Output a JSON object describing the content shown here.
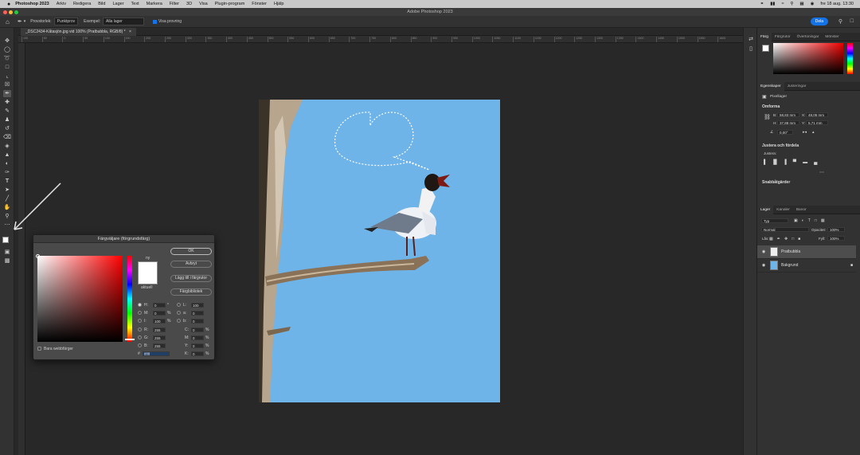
{
  "menubar": {
    "apple": "",
    "app_name": "Photoshop 2023",
    "items": [
      "Arkiv",
      "Redigera",
      "Bild",
      "Lager",
      "Text",
      "Markera",
      "Filter",
      "3D",
      "Visa",
      "Plugin-program",
      "Fönster",
      "Hjälp"
    ],
    "clock": "fre 18 aug. 13:30"
  },
  "window": {
    "title": "Adobe Photoshop 2023"
  },
  "options_bar": {
    "sample_size_label": "Provstorlek:",
    "sample_size_value": "Punktprov",
    "sample_label": "Exempel:",
    "sample_value": "Alla lager",
    "show_ring_label": "Visa provring",
    "share_label": "Dela"
  },
  "document": {
    "tab_label": "_DSC2434-Kåtasjön.jpg vid 100% (Pratbubbla, RGB/8) *"
  },
  "ruler": {
    "ticks": [
      "100",
      "50",
      "0",
      "50",
      "100",
      "150",
      "200",
      "250",
      "300",
      "350",
      "400",
      "450",
      "500",
      "550",
      "600",
      "650",
      "700",
      "750",
      "800",
      "850",
      "900",
      "950",
      "1000",
      "1050",
      "1100",
      "1150",
      "1200",
      "1250",
      "1300",
      "1350",
      "1400",
      "1450",
      "1500",
      "1550",
      "1600"
    ]
  },
  "color_picker": {
    "title": "Färgväljare (förgrundsfärg)",
    "new_label": "ny",
    "current_label": "aktuell",
    "ok": "OK",
    "cancel": "Avbryt",
    "add_swatch": "Lägg till i färgrutor",
    "libraries": "Färgbibliotek",
    "web_only": "Bara webbfärger",
    "hsb": {
      "H": "0",
      "H_unit": "°",
      "S": "0",
      "S_unit": "%",
      "B": "100",
      "B_unit": "%"
    },
    "rgb": {
      "R": "255",
      "G": "255",
      "B": "255"
    },
    "lab": {
      "L": "100",
      "a": "0",
      "b": "0"
    },
    "cmyk": {
      "C": "0",
      "M": "0",
      "Y": "0",
      "K": "0",
      "unit": "%"
    },
    "hex_label": "#",
    "hex": "ffffff",
    "labels": {
      "H": "H:",
      "S": "M:",
      "B": "I:",
      "R": "R:",
      "G": "G:",
      "Bb": "B:",
      "L": "L:",
      "a": "a:",
      "b": "b:",
      "C": "C:",
      "M": "M:",
      "Y": "Y:",
      "K": "K:"
    }
  },
  "panels": {
    "color_tabs": [
      "Färg",
      "Färgrutor",
      "Övertoningar",
      "Mönster"
    ],
    "props_tabs": [
      "Egenskaper",
      "Justeringar"
    ],
    "pixel_layer": "Pixellager",
    "transform": "Omforma",
    "W": "58,83 mm",
    "X": "48,05 mm",
    "H": "37,88 mm",
    "Y": "5,71 mm",
    "W_label": "B:",
    "X_label": "X:",
    "H_label": "H:",
    "Y_label": "Y:",
    "angle": "0,00°",
    "align": "Justera och fördela",
    "align_label": "Justera:",
    "quick": "Snabbåtgärder",
    "layers_tabs": [
      "Lager",
      "Kanaler",
      "Banor"
    ],
    "kind": "Typ",
    "blend": "Normal",
    "opacity_label": "Opacitet:",
    "opacity": "100%",
    "lock_label": "Lås:",
    "fill_label": "Fyll:",
    "fill": "100%",
    "layers": [
      {
        "name": "Pratbubbla",
        "selected": true
      },
      {
        "name": "Bakgrund",
        "selected": false
      }
    ]
  },
  "colors": {
    "accent": "#1473e6",
    "sky": "#6fb4e8"
  }
}
